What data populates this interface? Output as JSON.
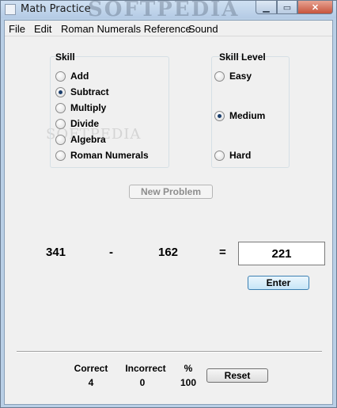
{
  "window": {
    "title": "Math Practice",
    "watermark": "SOFTPEDIA",
    "buttons": [
      "minimize",
      "maximize",
      "close"
    ]
  },
  "menu": [
    "File",
    "Edit",
    "Roman Numerals Reference",
    "Sound"
  ],
  "skill": {
    "title": "Skill",
    "options": [
      {
        "label": "Add",
        "selected": false
      },
      {
        "label": "Subtract",
        "selected": true
      },
      {
        "label": "Multiply",
        "selected": false
      },
      {
        "label": "Divide",
        "selected": false
      },
      {
        "label": "Algebra",
        "selected": false
      },
      {
        "label": "Roman Numerals",
        "selected": false
      }
    ]
  },
  "skill_level": {
    "title": "Skill Level",
    "options": [
      {
        "label": "Easy",
        "selected": false
      },
      {
        "label": "Medium",
        "selected": true
      },
      {
        "label": "Hard",
        "selected": false
      }
    ]
  },
  "new_problem_label": "New Problem",
  "problem": {
    "operand1": "341",
    "operator": "-",
    "operand2": "162",
    "equals": "=",
    "answer": "221"
  },
  "enter_label": "Enter",
  "stats": {
    "correct_label": "Correct",
    "correct": "4",
    "incorrect_label": "Incorrect",
    "incorrect": "0",
    "percent_label": "%",
    "percent": "100"
  },
  "reset_label": "Reset",
  "watermark_mid": "SOFTPEDIA"
}
